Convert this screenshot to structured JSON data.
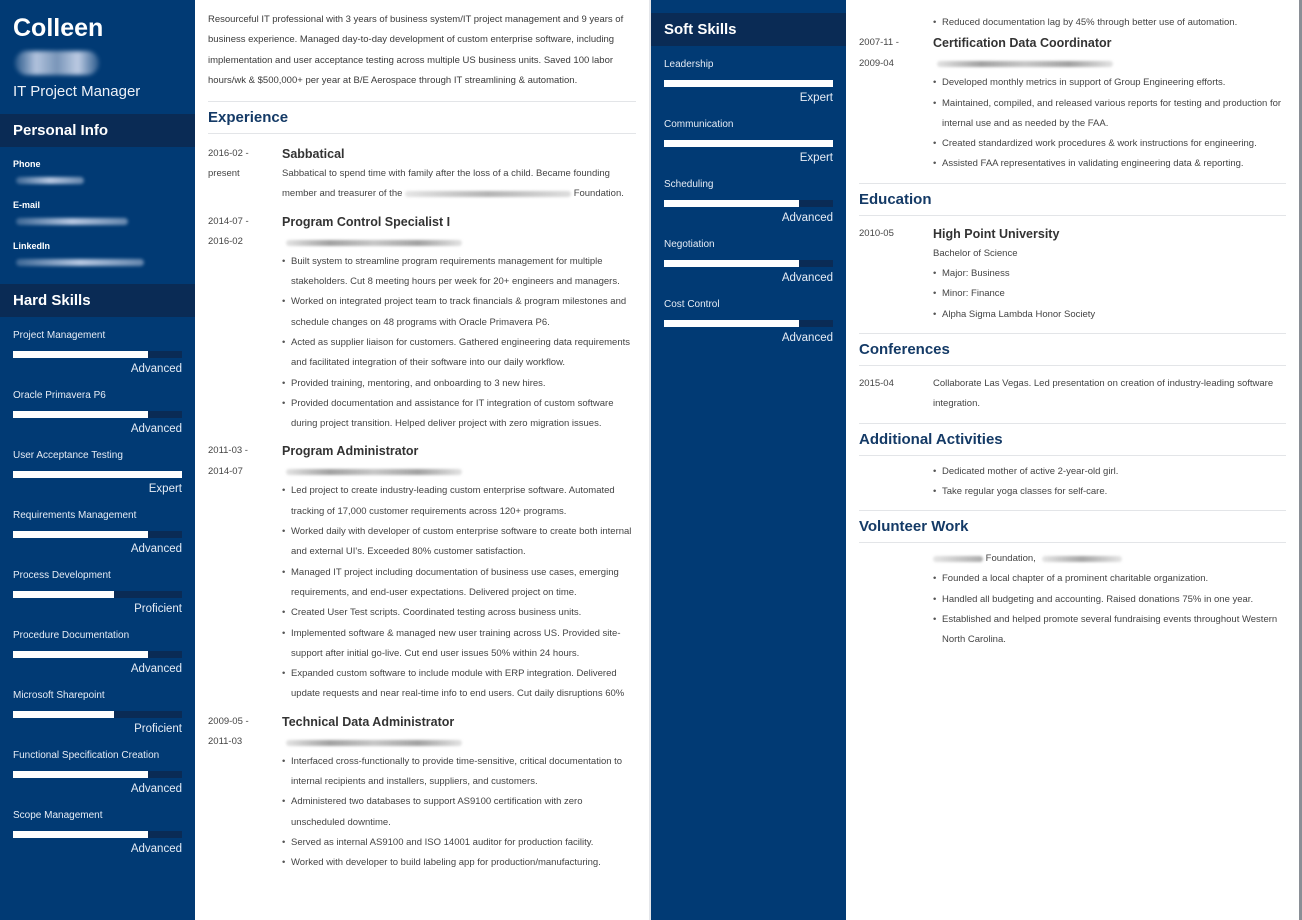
{
  "left_page": {
    "sidebar": {
      "name": "Colleen",
      "job_title": "IT Project Manager",
      "personal_info": {
        "heading": "Personal Info",
        "fields": [
          {
            "label": "Phone"
          },
          {
            "label": "E-mail"
          },
          {
            "label": "LinkedIn"
          }
        ]
      },
      "hard_skills": {
        "heading": "Hard Skills",
        "items": [
          {
            "name": "Project Management",
            "level": "Advanced",
            "fill": 0.8
          },
          {
            "name": "Oracle Primavera P6",
            "level": "Advanced",
            "fill": 0.8
          },
          {
            "name": "User Acceptance Testing",
            "level": "Expert",
            "fill": 1.0
          },
          {
            "name": "Requirements Management",
            "level": "Advanced",
            "fill": 0.8
          },
          {
            "name": "Process Development",
            "level": "Proficient",
            "fill": 0.6
          },
          {
            "name": "Procedure Documentation",
            "level": "Advanced",
            "fill": 0.8
          },
          {
            "name": "Microsoft Sharepoint",
            "level": "Proficient",
            "fill": 0.6
          },
          {
            "name": "Functional Specification Creation",
            "level": "Advanced",
            "fill": 0.8
          },
          {
            "name": "Scope Management",
            "level": "Advanced",
            "fill": 0.8
          }
        ]
      }
    },
    "main": {
      "summary": "Resourceful IT professional with 3 years of business system/IT project management and 9 years of business experience. Managed day-to-day development of custom enterprise software, including implementation and user acceptance testing across multiple US business units. Saved 100 labor hours/wk & $500,000+ per year at B/E Aerospace through IT streamlining & automation.",
      "experience_heading": "Experience",
      "jobs": [
        {
          "date_start": "2016-02 -",
          "date_end": "present",
          "title": "Sabbatical",
          "text_before": "Sabbatical to spend time with family after the loss of a child. Became founding member and treasurer of the",
          "text_after": "Foundation."
        },
        {
          "date_start": "2014-07 -",
          "date_end": "2016-02",
          "title": "Program Control Specialist I",
          "bullets": [
            "Built system to streamline program requirements management for multiple stakeholders. Cut 8 meeting hours per week for 20+ engineers and managers.",
            "Worked on integrated project team to track financials & program milestones and schedule changes on 48 programs with Oracle Primavera P6.",
            "Acted as supplier liaison for customers. Gathered engineering data requirements and facilitated integration of their software into our daily workflow.",
            "Provided training, mentoring, and onboarding to 3 new hires.",
            "Provided documentation and assistance for IT integration of custom software during project transition. Helped deliver project with zero migration issues."
          ]
        },
        {
          "date_start": "2011-03 -",
          "date_end": "2014-07",
          "title": "Program Administrator",
          "bullets": [
            "Led project to create industry-leading custom enterprise software. Automated tracking of 17,000 customer requirements across 120+ programs.",
            "Worked daily with developer of custom enterprise software to create both internal and external UI's. Exceeded 80% customer satisfaction.",
            "Managed IT project including documentation of business use cases, emerging requirements, and end-user expectations. Delivered project on time.",
            "Created User Test scripts. Coordinated testing across business units.",
            "Implemented software & managed new user training across US. Provided site-support after initial go-live. Cut end user issues 50% within 24 hours.",
            "Expanded custom software to include module with ERP integration. Delivered update requests and near real-time info to end users. Cut daily disruptions 60%"
          ]
        },
        {
          "date_start": "2009-05 -",
          "date_end": "2011-03",
          "title": "Technical Data Administrator",
          "bullets": [
            "Interfaced cross-functionally to provide time-sensitive, critical documentation to internal recipients and installers, suppliers, and customers.",
            "Administered two databases to support AS9100 certification with zero unscheduled downtime.",
            "Served as internal AS9100 and ISO 14001 auditor for production facility.",
            "Worked with developer to build labeling app for production/manufacturing."
          ]
        }
      ]
    }
  },
  "right_page": {
    "sidebar": {
      "soft_skills": {
        "heading": "Soft Skills",
        "items": [
          {
            "name": "Leadership",
            "level": "Expert",
            "fill": 1.0
          },
          {
            "name": "Communication",
            "level": "Expert",
            "fill": 1.0
          },
          {
            "name": "Scheduling",
            "level": "Advanced",
            "fill": 0.8
          },
          {
            "name": "Negotiation",
            "level": "Advanced",
            "fill": 0.8
          },
          {
            "name": "Cost Control",
            "level": "Advanced",
            "fill": 0.8
          }
        ]
      }
    },
    "main": {
      "continued_bullet": "Reduced documentation lag by 45% through better use of automation.",
      "cert_job": {
        "date_start": "2007-11 -",
        "date_end": "2009-04",
        "title": "Certification Data Coordinator",
        "bullets": [
          "Developed monthly metrics in support of Group Engineering efforts.",
          "Maintained, compiled, and released various reports for testing and production for internal use and as needed by the FAA.",
          "Created standardized work procedures & work instructions for engineering.",
          "Assisted FAA representatives in validating engineering data & reporting."
        ]
      },
      "education": {
        "heading": "Education",
        "date": "2010-05",
        "school": "High Point University",
        "degree": "Bachelor of Science",
        "bullets": [
          "Major: Business",
          "Minor: Finance",
          "Alpha Sigma Lambda Honor Society"
        ]
      },
      "conferences": {
        "heading": "Conferences",
        "date": "2015-04",
        "text": "Collaborate Las Vegas. Led presentation on creation of industry-leading software integration."
      },
      "additional_activities": {
        "heading": "Additional Activities",
        "bullets": [
          "Dedicated mother of active 2-year-old girl.",
          "Take regular yoga classes for self-care."
        ]
      },
      "volunteer_work": {
        "heading": "Volunteer Work",
        "org_suffix": "Foundation,",
        "bullets": [
          "Founded a local chapter of a prominent charitable organization.",
          "Handled all budgeting and accounting. Raised donations 75% in one year.",
          "Established and helped promote several fundraising events throughout Western North Carolina."
        ]
      }
    }
  }
}
